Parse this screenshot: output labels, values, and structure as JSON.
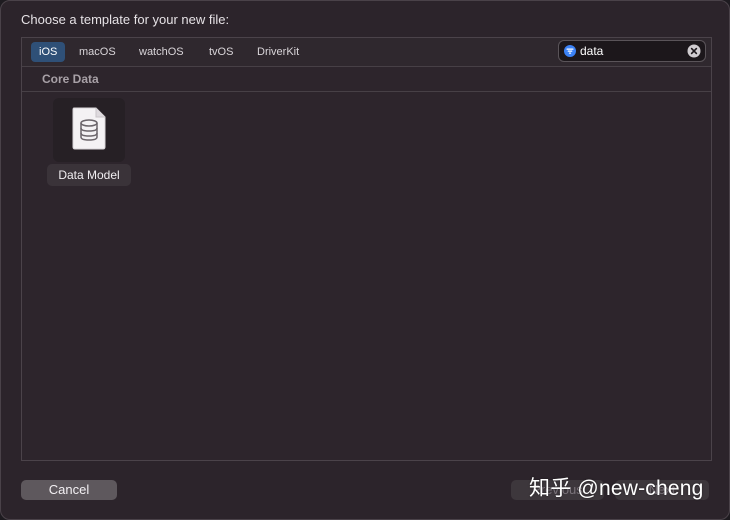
{
  "dialog": {
    "title": "Choose a template for your new file:"
  },
  "platform_tabs": [
    {
      "label": "iOS",
      "selected": true
    },
    {
      "label": "macOS",
      "selected": false
    },
    {
      "label": "watchOS",
      "selected": false
    },
    {
      "label": "tvOS",
      "selected": false
    },
    {
      "label": "DriverKit",
      "selected": false
    }
  ],
  "search": {
    "value": "data",
    "filter_icon": "filter-icon",
    "clear_icon": "clear-icon",
    "accent_color": "#3b82f6"
  },
  "section": {
    "title": "Core Data"
  },
  "templates": [
    {
      "label": "Data Model",
      "icon": "database-document-icon"
    }
  ],
  "buttons": {
    "cancel": "Cancel",
    "previous": "Previous",
    "next": "Next"
  },
  "watermark": {
    "text": "知乎 @new-cheng"
  }
}
